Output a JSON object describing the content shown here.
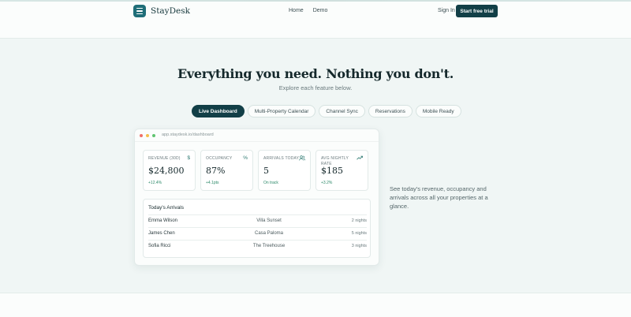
{
  "nav": {
    "brand": "StayDesk",
    "links": [
      "Home",
      "Demo"
    ],
    "signin": "Sign In",
    "cta": "Start free trial"
  },
  "hero": {
    "headline": "Everything you need. Nothing you don't.",
    "subline": "Explore each feature below."
  },
  "tabs": [
    {
      "label": "Live Dashboard",
      "active": true
    },
    {
      "label": "Multi-Property Calendar",
      "active": false
    },
    {
      "label": "Channel Sync",
      "active": false
    },
    {
      "label": "Reservations",
      "active": false
    },
    {
      "label": "Mobile Ready",
      "active": false
    }
  ],
  "window": {
    "url": "app.staydesk.io/dashboard"
  },
  "stats": [
    {
      "label": "Revenue (30d)",
      "value": "$24,800",
      "delta": "+12.4%",
      "icon": "dollar-icon"
    },
    {
      "label": "Occupancy",
      "value": "87%",
      "delta": "+4.1pts",
      "icon": "percent-icon"
    },
    {
      "label": "Arrivals Today",
      "value": "5",
      "delta": "On track",
      "icon": "users-icon"
    },
    {
      "label": "Avg Nightly Rate",
      "value": "$185",
      "delta": "+3.2%",
      "icon": "trend-up-icon"
    }
  ],
  "arrivals": {
    "title": "Today's Arrivals",
    "rows": [
      {
        "guest": "Emma Wilson",
        "property": "Villa Sunset",
        "nights": "2 nights"
      },
      {
        "guest": "James Chen",
        "property": "Casa Paloma",
        "nights": "5 nights"
      },
      {
        "guest": "Sofia Ricci",
        "property": "The Treehouse",
        "nights": "3 nights"
      }
    ]
  },
  "description": "See today's revenue, occupancy and arrivals across all your properties at a glance.",
  "colors": {
    "accent": "#123f47",
    "brand": "#1f6e78",
    "positive": "#2e8a6a",
    "background": "#f0f6f5"
  }
}
